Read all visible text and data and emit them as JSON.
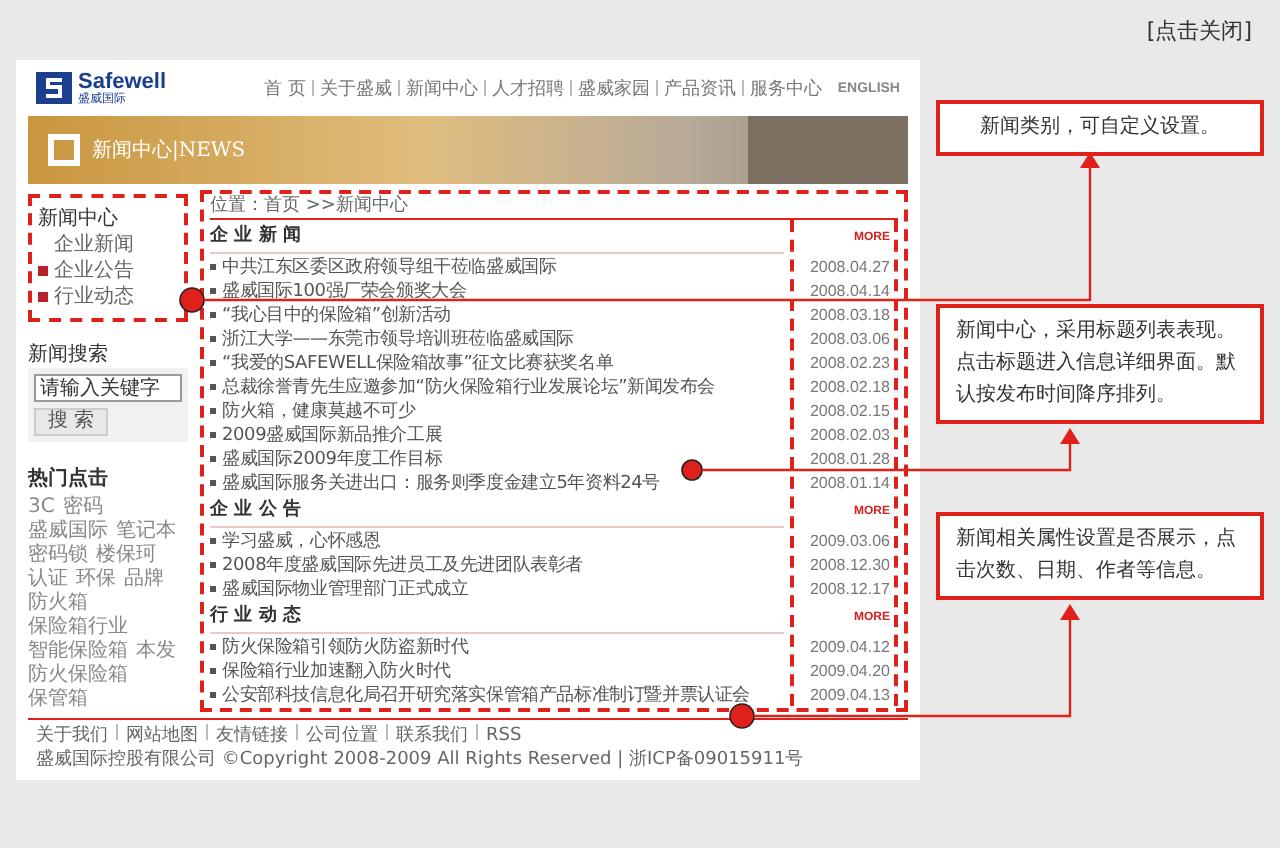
{
  "close_link": "[点击关闭]",
  "site": {
    "logo": {
      "name": "Safewell",
      "subtitle": "盛威国际"
    },
    "nav": [
      "首 页",
      "关于盛威",
      "新闻中心",
      "人才招聘",
      "盛威家园",
      "产品资讯",
      "服务中心",
      "ENGLISH"
    ],
    "banner": {
      "title": "新闻中心|NEWS"
    },
    "sidebar": {
      "category_title": "新闻中心",
      "categories": [
        {
          "label": "企业新闻",
          "bullet": false
        },
        {
          "label": "企业公告",
          "bullet": true
        },
        {
          "label": "行业动态",
          "bullet": true
        }
      ],
      "search": {
        "title": "新闻搜索",
        "value": "请输入关键字",
        "button": "搜 索"
      },
      "hot": {
        "title": "热门点击",
        "tags": [
          "3C",
          "密码",
          "盛威国际",
          "笔记本",
          "密码锁",
          "楼保珂",
          "认证",
          "环保",
          "品牌",
          "防火箱",
          "保险箱行业",
          "智能保险箱",
          "本发",
          "防火保险箱",
          "保管箱"
        ]
      }
    },
    "breadcrumb": "位置：首页 >>新闻中心",
    "sections": [
      {
        "title": "企 业 新 闻",
        "more": "MORE",
        "items": [
          {
            "title": "中共江东区委区政府领导组干莅临盛威国际",
            "date": "2008.04.27"
          },
          {
            "title": "盛威国际100强厂荣会颁奖大会",
            "date": "2008.04.14"
          },
          {
            "title": "“我心目中的保险箱”创新活动",
            "date": "2008.03.18"
          },
          {
            "title": "浙江大学——东莞市领导培训班莅临盛威国际",
            "date": "2008.03.06"
          },
          {
            "title": "“我爱的SAFEWELL保险箱故事”征文比赛获奖名单",
            "date": "2008.02.23"
          },
          {
            "title": "总裁徐誉青先生应邀参加“防火保险箱行业发展论坛”新闻发布会",
            "date": "2008.02.18"
          },
          {
            "title": "防火箱，健康莫越不可少",
            "date": "2008.02.15"
          },
          {
            "title": "2009盛威国际新品推介工展",
            "date": "2008.02.03"
          },
          {
            "title": "盛威国际2009年度工作目标",
            "date": "2008.01.28"
          },
          {
            "title": "盛威国际服务关进出口：服务则季度金建立5年资料24号",
            "date": "2008.01.14"
          }
        ]
      },
      {
        "title": "企 业 公 告",
        "more": "MORE",
        "items": [
          {
            "title": "学习盛威，心怀感恩",
            "date": "2009.03.06"
          },
          {
            "title": "2008年度盛威国际先进员工及先进团队表彰者",
            "date": "2008.12.30"
          },
          {
            "title": "盛威国际物业管理部门正式成立",
            "date": "2008.12.17"
          }
        ]
      },
      {
        "title": "行 业 动 态",
        "more": "MORE",
        "items": [
          {
            "title": "防火保险箱引领防火防盗新时代",
            "date": "2009.04.12"
          },
          {
            "title": "保险箱行业加速翻入防火时代",
            "date": "2009.04.20"
          },
          {
            "title": "公安部科技信息化局召开研究落实保管箱产品标准制订暨并票认证会",
            "date": "2009.04.13"
          }
        ]
      }
    ],
    "footer": {
      "links": [
        "关于我们",
        "网站地图",
        "友情链接",
        "公司位置",
        "联系我们",
        "RSS"
      ],
      "copyright": "盛威国际控股有限公司 ©Copyright 2008-2009 All Rights Reserved | 浙ICP备09015911号"
    }
  },
  "annotations": [
    {
      "text": "新闻类别，可自定义设置。"
    },
    {
      "text": "新闻中心，采用标题列表表现。点击标题进入信息详细界面。默认按发布时间降序排列。"
    },
    {
      "text": "新闻相关属性设置是否展示，点击次数、日期、作者等信息。"
    }
  ]
}
